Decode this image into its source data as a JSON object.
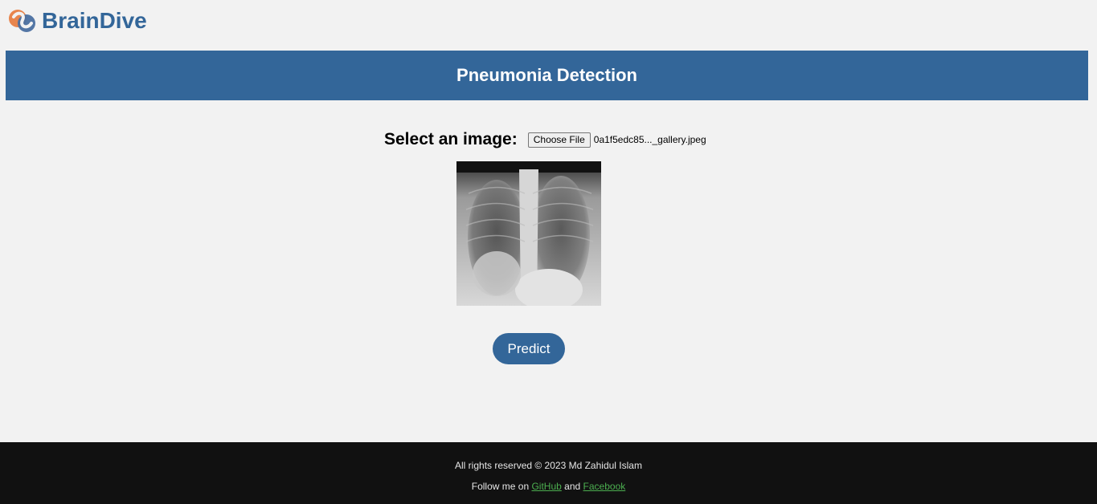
{
  "brand": {
    "name": "BrainDive",
    "logo_icon": "brain-dive-logo-icon"
  },
  "header": {
    "title": "Pneumonia Detection"
  },
  "upload": {
    "label": "Select an image:",
    "button_label": "Choose File",
    "file_name": "0a1f5edc85..._gallery.jpeg"
  },
  "preview": {
    "alt": "chest-xray-preview"
  },
  "actions": {
    "predict_label": "Predict"
  },
  "footer": {
    "copyright": "All rights reserved © 2023 Md Zahidul Islam",
    "follow_prefix": "Follow me on",
    "github_label": "GitHub",
    "and_text": "and",
    "facebook_label": "Facebook"
  },
  "colors": {
    "primary": "#336699",
    "footer_bg": "#111111",
    "link": "#4caf50",
    "page_bg": "#f2f2f2"
  }
}
